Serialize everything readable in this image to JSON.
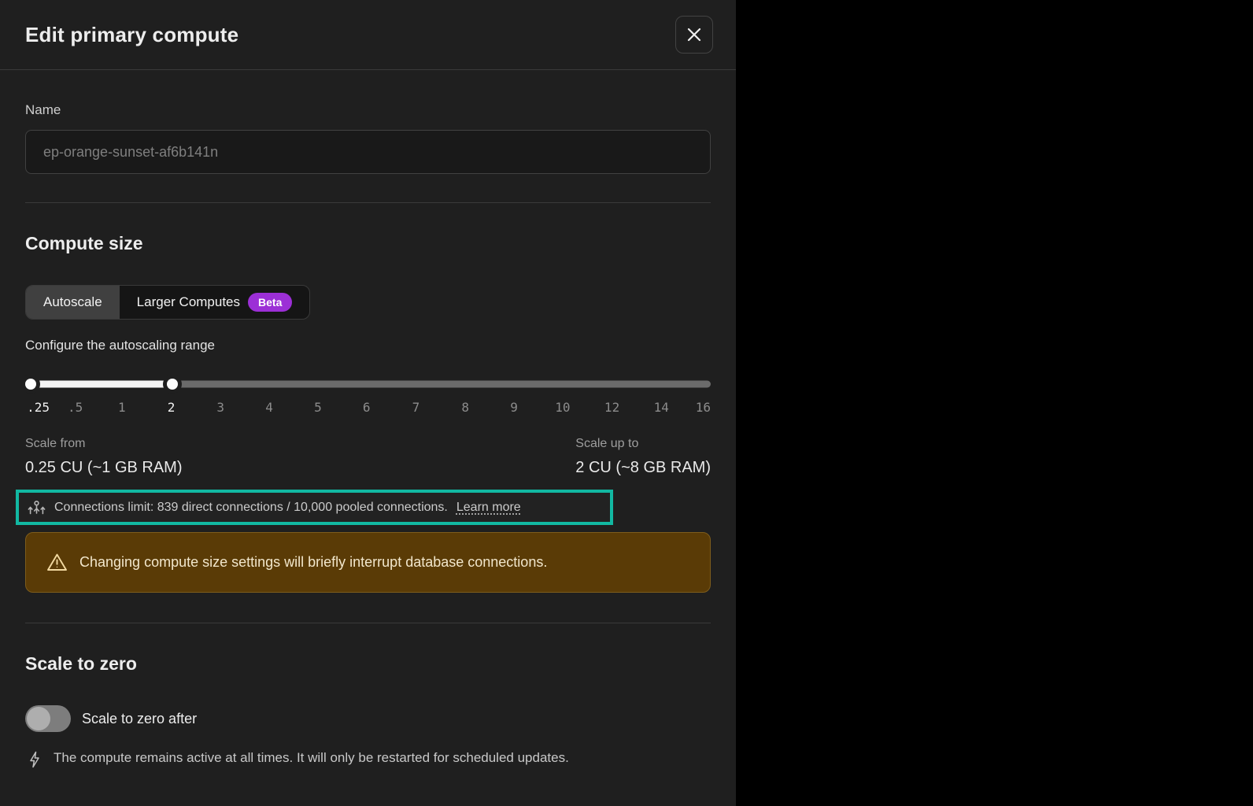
{
  "modal": {
    "title": "Edit primary compute"
  },
  "name_section": {
    "label": "Name",
    "placeholder": "ep-orange-sunset-af6b141n"
  },
  "compute_size": {
    "heading": "Compute size",
    "tabs": [
      {
        "label": "Autoscale",
        "selected": true
      },
      {
        "label": "Larger Computes",
        "selected": false,
        "badge": "Beta"
      }
    ],
    "range_label": "Configure the autoscaling range",
    "slider": {
      "ticks": [
        ".25",
        ".5",
        "1",
        "2",
        "3",
        "4",
        "5",
        "6",
        "7",
        "8",
        "9",
        "10",
        "12",
        "14",
        "16"
      ],
      "active_ticks": [
        ".25",
        "2"
      ],
      "min_value": "0.25",
      "max_value": "2"
    },
    "scale_from": {
      "label": "Scale from",
      "value": "0.25 CU (~1 GB RAM)"
    },
    "scale_up_to": {
      "label": "Scale up to",
      "value": "2 CU (~8 GB RAM)"
    },
    "connections_note": {
      "text": "Connections limit: 839 direct connections / 10,000 pooled connections.",
      "link_label": "Learn more"
    },
    "warning": "Changing compute size settings will briefly interrupt database connections."
  },
  "scale_to_zero": {
    "heading": "Scale to zero",
    "toggle_label": "Scale to zero after",
    "toggle_state": "off",
    "note": "The compute remains active at all times. It will only be restarted for scheduled updates."
  },
  "colors": {
    "highlight": "#12b8a2",
    "beta_badge": "#9c2fd6",
    "warning_bg": "#5a3b06",
    "warning_border": "#7d5c1c",
    "warning_text": "#f2e7cc",
    "panel_bg": "#1f1f1f"
  }
}
